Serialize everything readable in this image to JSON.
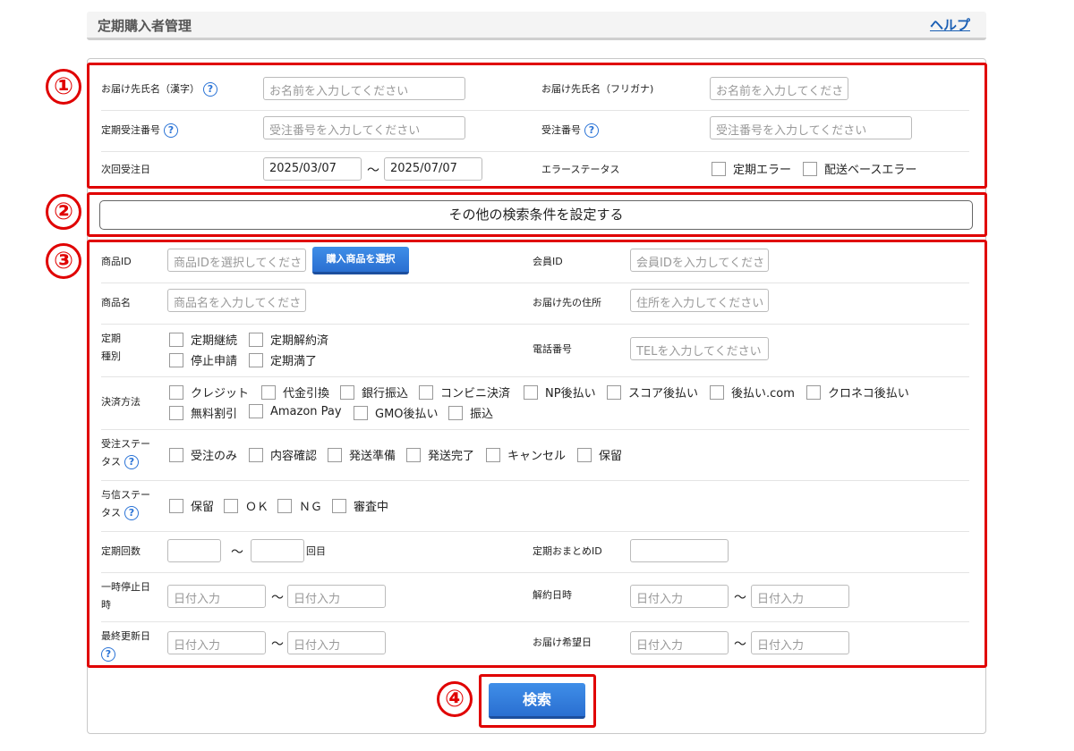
{
  "header": {
    "title": "定期購入者管理",
    "help": "ヘルプ"
  },
  "markers": [
    "①",
    "②",
    "③",
    "④"
  ],
  "section1": {
    "name_kanji": {
      "label": "お届け先氏名（漢字）",
      "placeholder": "お名前を入力してください"
    },
    "name_kana": {
      "label": "お届け先氏名（フリガナ)",
      "placeholder": "お名前を入力してくださ"
    },
    "sub_order_no": {
      "label": "定期受注番号",
      "placeholder": "受注番号を入力してください"
    },
    "order_no": {
      "label": "受注番号",
      "placeholder": "受注番号を入力してください"
    },
    "next_date": {
      "label": "次回受注日",
      "from": "2025/03/07",
      "to": "2025/07/07",
      "tilde": "～"
    },
    "error_status": {
      "label": "エラーステータス",
      "options": [
        "定期エラー",
        "配送ベースエラー"
      ]
    }
  },
  "section2": {
    "label": "その他の検索条件を設定する"
  },
  "section3": {
    "product_id": {
      "label": "商品ID",
      "placeholder": "商品IDを選択してくださ",
      "button": "購入商品を選択"
    },
    "member_id": {
      "label": "会員ID",
      "placeholder": "会員IDを入力してくださ"
    },
    "product_name": {
      "label": "商品名",
      "placeholder": "商品名を入力してくださ"
    },
    "address": {
      "label": "お届け先の住所",
      "placeholder": "住所を入力してください"
    },
    "sub_type": {
      "label1": "定期",
      "label2": "種別",
      "options": [
        "定期継続",
        "定期解約済",
        "停止申請",
        "定期満了"
      ]
    },
    "phone": {
      "label": "電話番号",
      "placeholder": "TELを入力してください"
    },
    "payment": {
      "label": "決済方法",
      "row1": [
        "クレジット",
        "代金引換",
        "銀行振込",
        "コンビニ決済",
        "NP後払い",
        "スコア後払い",
        "後払い.com",
        "クロネコ後払い"
      ],
      "row2": [
        "無料割引",
        "Amazon Pay",
        "GMO後払い",
        "振込"
      ]
    },
    "order_status": {
      "label1": "受注ステー",
      "label2": "タス",
      "options": [
        "受注のみ",
        "内容確認",
        "発送準備",
        "発送完了",
        "キャンセル",
        "保留"
      ]
    },
    "credit_status": {
      "label1": "与信ステー",
      "label2": "タス",
      "options": [
        "保留",
        "ＯＫ",
        "ＮＧ",
        "審査中"
      ]
    },
    "count": {
      "label": "定期回数",
      "tilde": "～",
      "suffix": "回目"
    },
    "summary_id": {
      "label": "定期おまとめID"
    },
    "pause_date": {
      "label1": "一時停止日",
      "label2": "時",
      "placeholder": "日付入力",
      "tilde": "～"
    },
    "cancel_date": {
      "label": "解約日時",
      "placeholder": "日付入力",
      "tilde": "～"
    },
    "updated": {
      "label": "最終更新日",
      "placeholder": "日付入力",
      "tilde": "～"
    },
    "delivery_date": {
      "label": "お届け希望日",
      "placeholder": "日付入力",
      "tilde": "～"
    }
  },
  "search_button": "検索",
  "colors": {
    "accent_red": "#e00000",
    "button_blue": "#2a6fd1",
    "help_blue": "#1a5fb4"
  }
}
